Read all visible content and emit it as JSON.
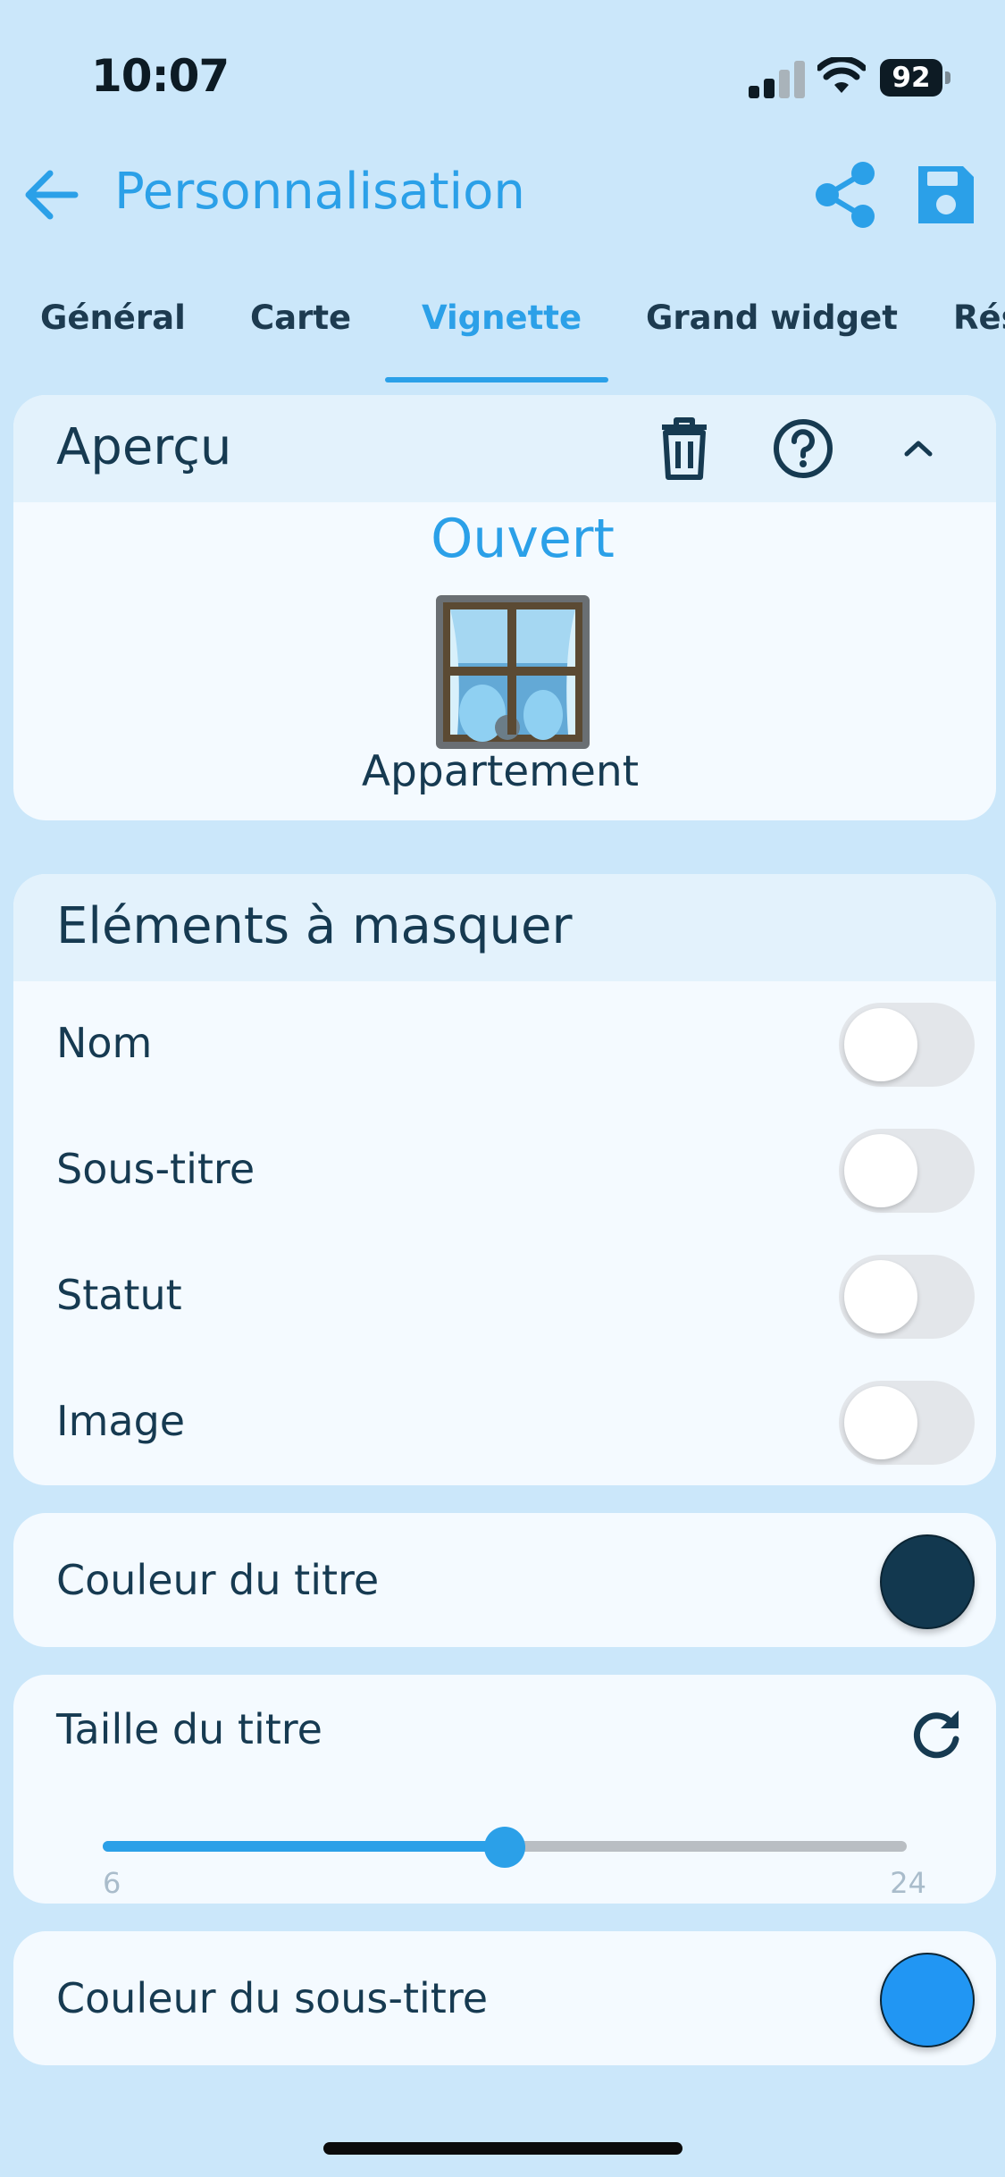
{
  "status_bar": {
    "time": "10:07",
    "battery": "92"
  },
  "header": {
    "title": "Personnalisation",
    "back_icon": "arrow-left-icon",
    "share_icon": "share-icon",
    "save_icon": "floppy-save-icon"
  },
  "tabs": [
    {
      "label": "Général",
      "active": false
    },
    {
      "label": "Carte",
      "active": false
    },
    {
      "label": "Vignette",
      "active": true
    },
    {
      "label": "Grand widget",
      "active": false
    },
    {
      "label": "Rés",
      "active": false
    }
  ],
  "preview": {
    "title": "Aperçu",
    "status": "Ouvert",
    "device_name": "Appartement",
    "image_icon": "window-icon",
    "actions": [
      "trash-icon",
      "help-icon",
      "chevron-up-icon"
    ]
  },
  "hide_elements": {
    "title": "Eléments à masquer",
    "items": [
      {
        "label": "Nom",
        "on": false
      },
      {
        "label": "Sous-titre",
        "on": false
      },
      {
        "label": "Statut",
        "on": false
      },
      {
        "label": "Image",
        "on": false
      }
    ]
  },
  "title_color": {
    "label": "Couleur du titre",
    "color": "#12384f"
  },
  "title_size": {
    "label": "Taille du titre",
    "min": "6",
    "max": "24",
    "value": 15,
    "reset_icon": "refresh-icon"
  },
  "subtitle_color": {
    "label": "Couleur du sous-titre",
    "color": "#2196f3"
  },
  "colors": {
    "accent": "#2ba0e8",
    "background": "#cbe7fa",
    "card": "#f4faff",
    "card_header": "#e3f2fc",
    "text": "#163a51"
  }
}
